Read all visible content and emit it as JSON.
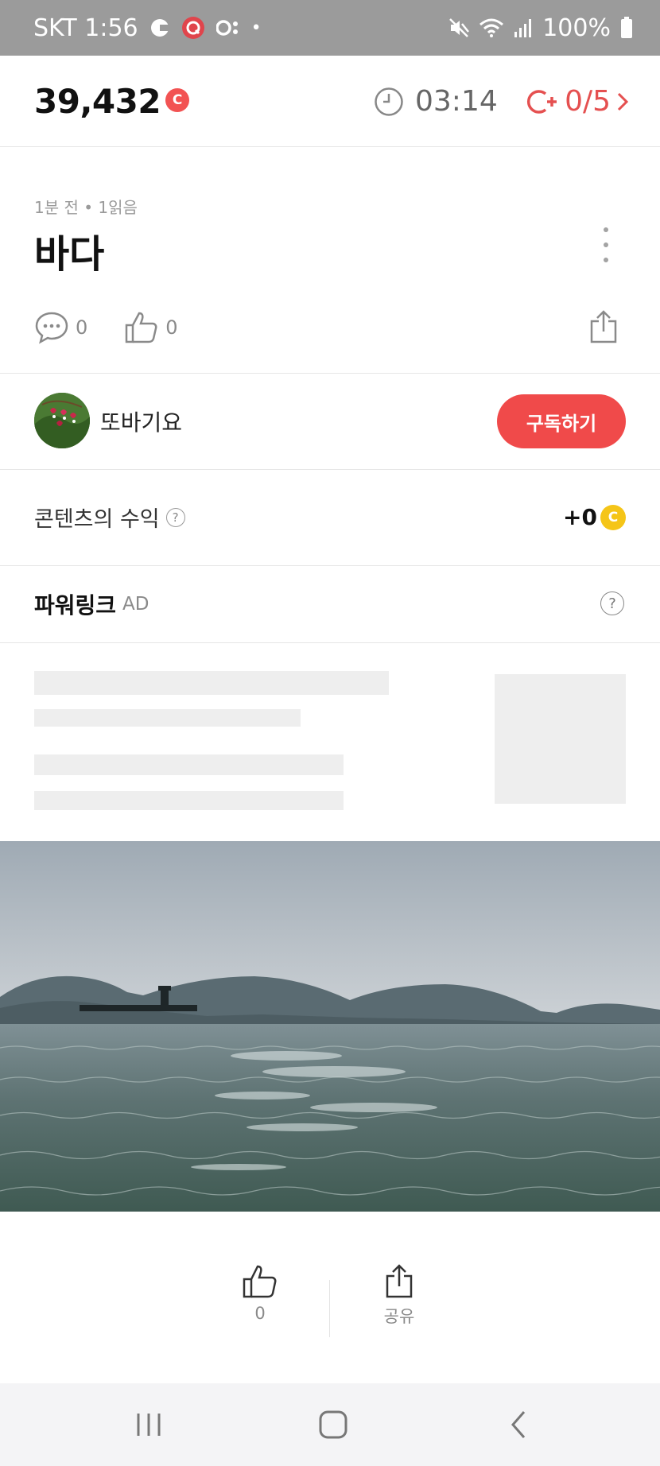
{
  "status_bar": {
    "carrier_time": "SKT 1:56",
    "dot": "•",
    "battery": "100%",
    "icons": [
      "moon-c-icon",
      "app-q-icon",
      "dots-icon",
      "mute-icon",
      "wifi-icon",
      "signal-icon",
      "battery-icon"
    ]
  },
  "header": {
    "points": "39,432",
    "points_coin": "C",
    "timer": "03:14",
    "cplus_count": "0/5"
  },
  "post": {
    "meta": "1분 전 • 1읽음",
    "title": "바다",
    "comment_count": "0",
    "like_count": "0"
  },
  "author": {
    "name": "또바기요",
    "subscribe_label": "구독하기"
  },
  "revenue": {
    "label": "콘텐츠의 수익",
    "help": "?",
    "value": "+0",
    "coin": "C"
  },
  "powerlink": {
    "title": "파워링크",
    "ad": "AD",
    "help": "?"
  },
  "bottom_actions": {
    "like_count": "0",
    "share_label": "공유"
  },
  "colors": {
    "accent_red": "#f04a4a",
    "coin_yellow": "#f5c518",
    "status_bar": "#9b9b9b"
  }
}
